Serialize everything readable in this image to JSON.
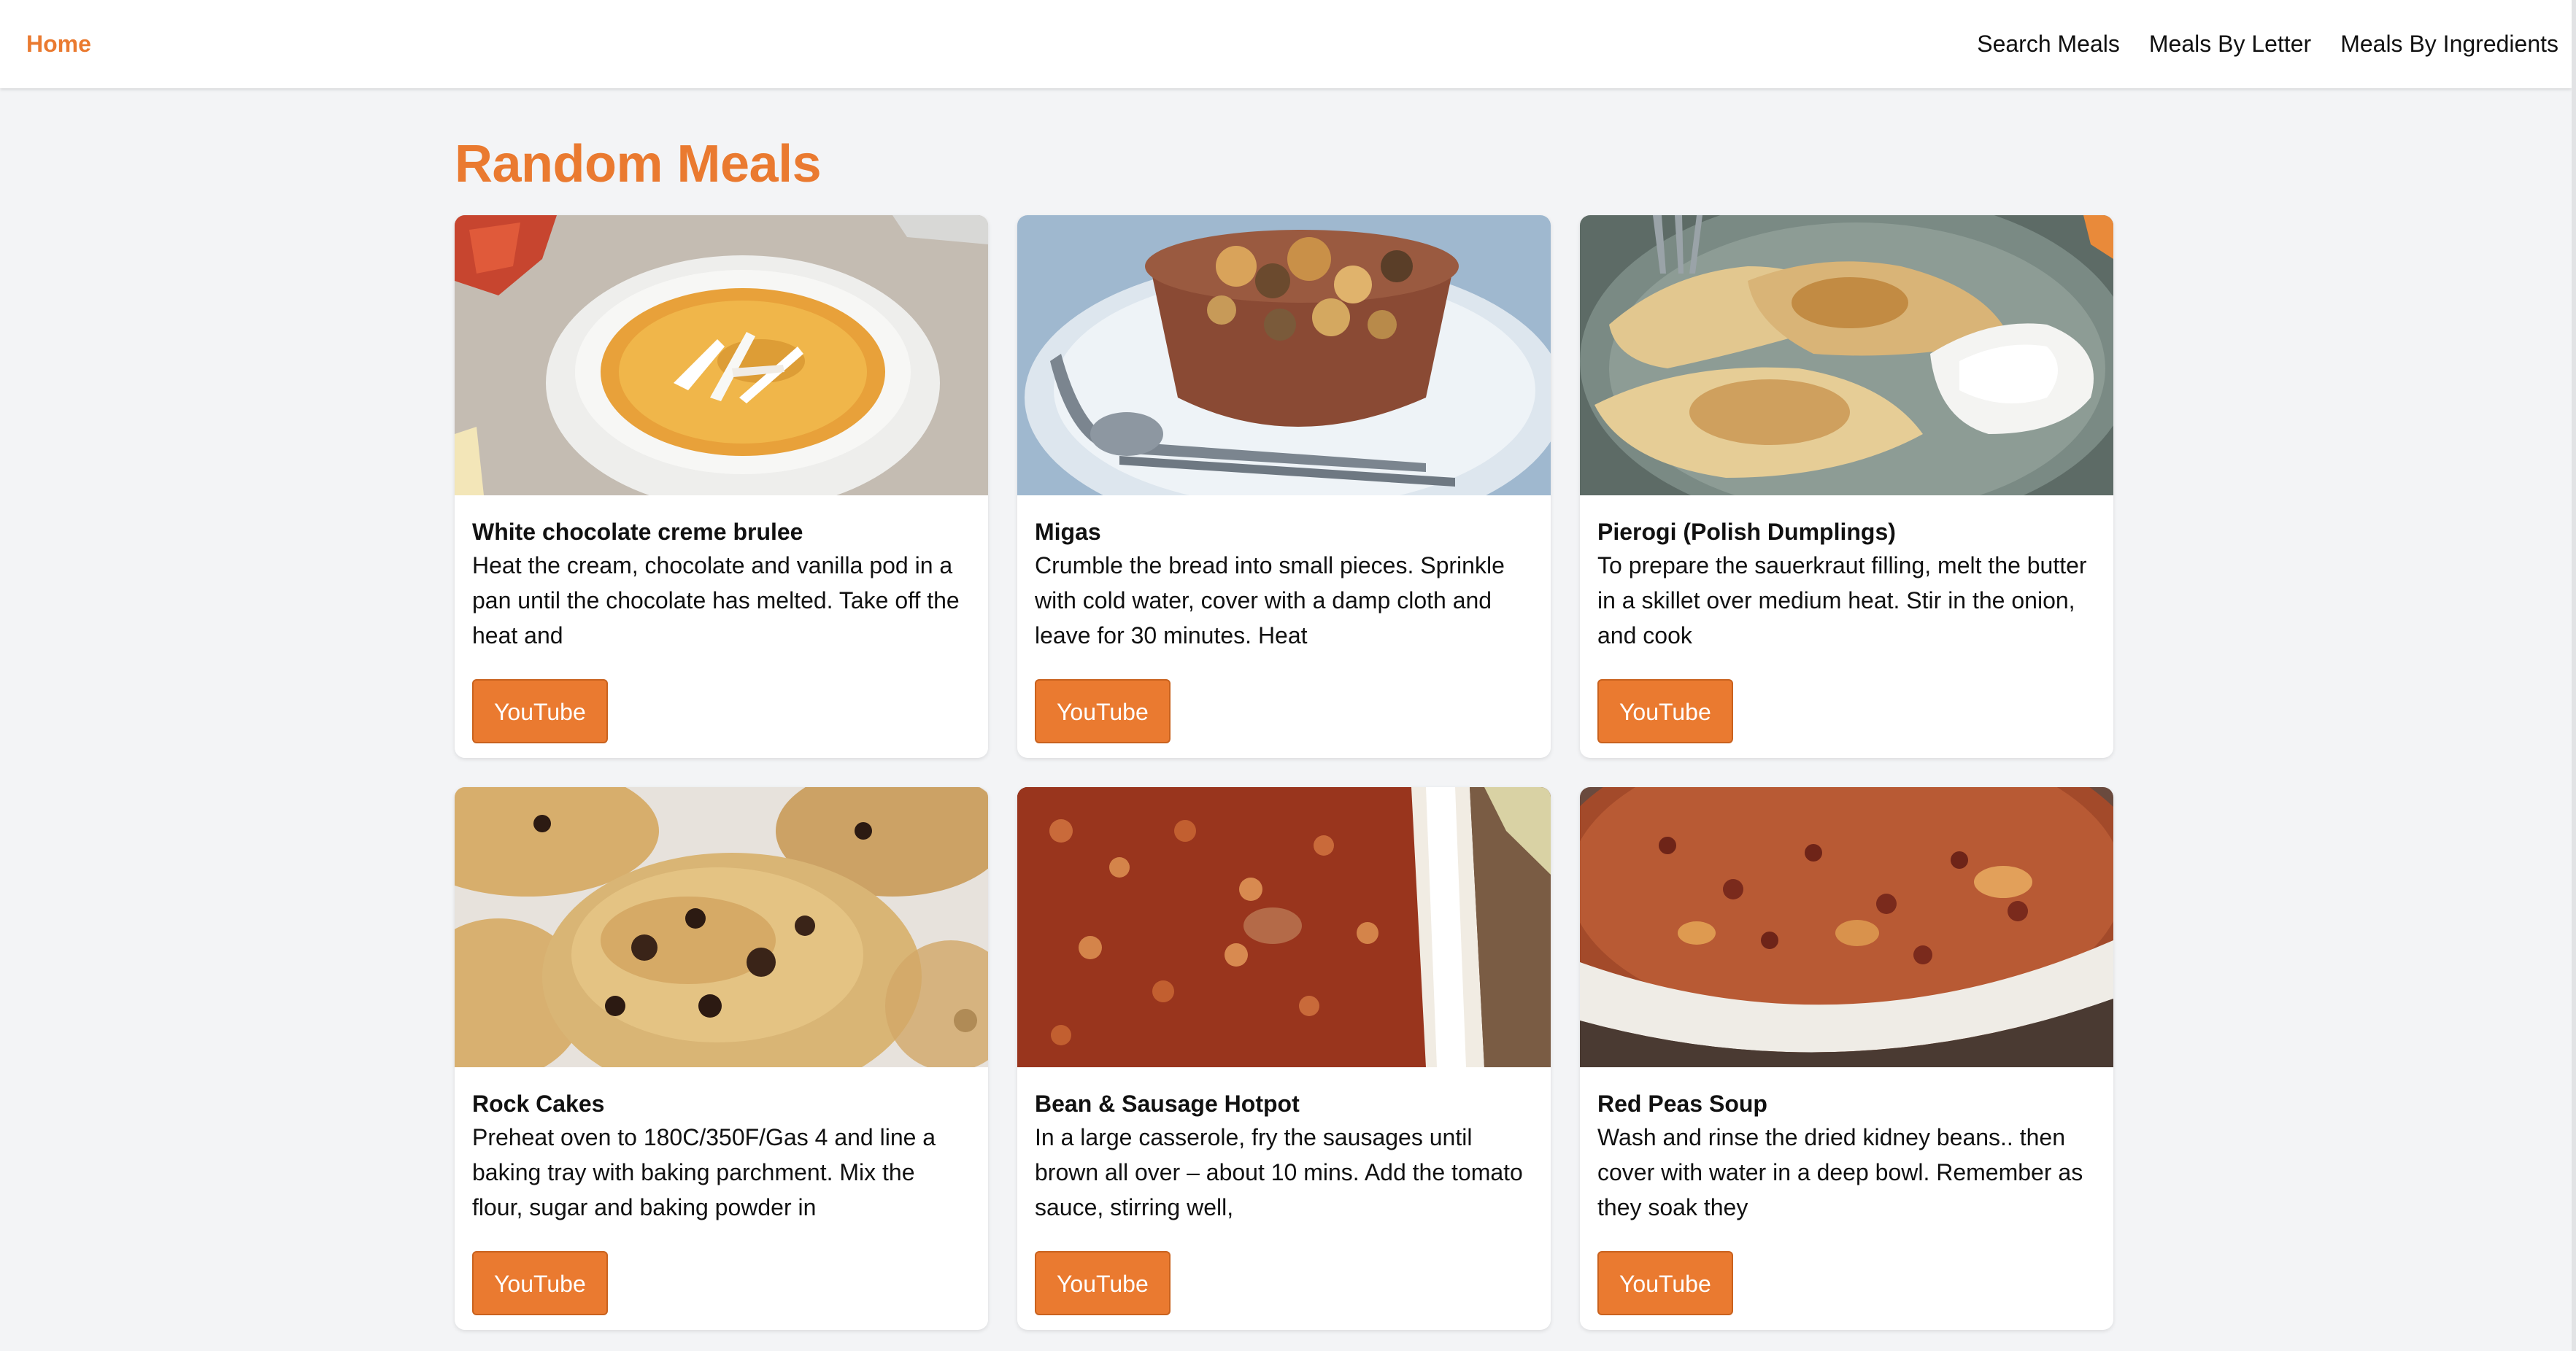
{
  "nav": {
    "home": "Home",
    "links": [
      "Search Meals",
      "Meals By Letter",
      "Meals By Ingredients"
    ]
  },
  "page": {
    "title": "Random Meals"
  },
  "meals": [
    {
      "name": "White chocolate creme brulee",
      "description": "Heat the cream, chocolate and vanilla pod in a pan until the chocolate has melted. Take off the heat and",
      "button": "YouTube"
    },
    {
      "name": "Migas",
      "description": "Crumble the bread into small pieces. Sprinkle with cold water, cover with a damp cloth and leave for 30 minutes. Heat",
      "button": "YouTube"
    },
    {
      "name": "Pierogi (Polish Dumplings)",
      "description": "To prepare the sauerkraut filling, melt the butter in a skillet over medium heat. Stir in the onion, and cook",
      "button": "YouTube"
    },
    {
      "name": "Rock Cakes",
      "description": "Preheat oven to 180C/350F/Gas 4 and line a baking tray with baking parchment. Mix the flour, sugar and baking powder in",
      "button": "YouTube"
    },
    {
      "name": "Bean & Sausage Hotpot",
      "description": "In a large casserole, fry the sausages until brown all over – about 10 mins. Add the tomato sauce, stirring well,",
      "button": "YouTube"
    },
    {
      "name": "Red Peas Soup",
      "description": "Wash and rinse the dried kidney beans.. then cover with water in a deep bowl. Remember as they soak they",
      "button": "YouTube"
    }
  ],
  "colors": {
    "accent": "#ea7a30",
    "background": "#f3f4f6",
    "card": "#ffffff"
  }
}
